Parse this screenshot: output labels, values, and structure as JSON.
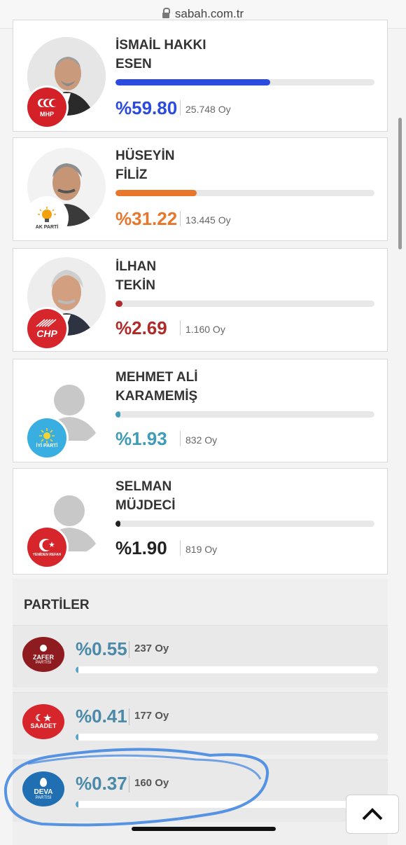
{
  "browser": {
    "url": "sabah.com.tr"
  },
  "candidates": [
    {
      "first": "İSMAİL HAKKI",
      "last": "ESEN",
      "percent": "%59.80",
      "votes": "25.748 Oy",
      "share": 0.598,
      "color": "#2b4be0",
      "party_logo": "MHP"
    },
    {
      "first": "HÜSEYİN",
      "last": "FİLİZ",
      "percent": "%31.22",
      "votes": "13.445 Oy",
      "share": 0.3122,
      "color": "#e8772e",
      "party_logo": "AK PARTİ"
    },
    {
      "first": "İLHAN",
      "last": "TEKİN",
      "percent": "%2.69",
      "votes": "1.160 Oy",
      "share": 0.0269,
      "color": "#b12a2a",
      "party_logo": "CHP"
    },
    {
      "first": "MEHMET ALİ",
      "last": "KARAMEMİŞ",
      "percent": "%1.93",
      "votes": "832 Oy",
      "share": 0.0193,
      "color": "#3e9cb4",
      "party_logo": "İYİ PARTİ"
    },
    {
      "first": "SELMAN",
      "last": "MÜJDECİ",
      "percent": "%1.90",
      "votes": "819 Oy",
      "share": 0.019,
      "color": "#222222",
      "party_logo": "YENİDEN REFAH"
    }
  ],
  "parties_section": {
    "title": "PARTİLER",
    "rows": [
      {
        "percent": "%0.55",
        "votes": "237 Oy",
        "share": 0.0055,
        "logo_text": "ZAFER",
        "logo_sub": "PARTİSİ"
      },
      {
        "percent": "%0.41",
        "votes": "177 Oy",
        "share": 0.0041,
        "logo_text": "SAADET",
        "logo_sub": ""
      },
      {
        "percent": "%0.37",
        "votes": "160 Oy",
        "share": 0.0037,
        "logo_text": "DEVA",
        "logo_sub": "PARTİSİ"
      }
    ]
  },
  "icons": {
    "scroll_top": "chevron-up-icon",
    "lock": "lock-icon"
  }
}
